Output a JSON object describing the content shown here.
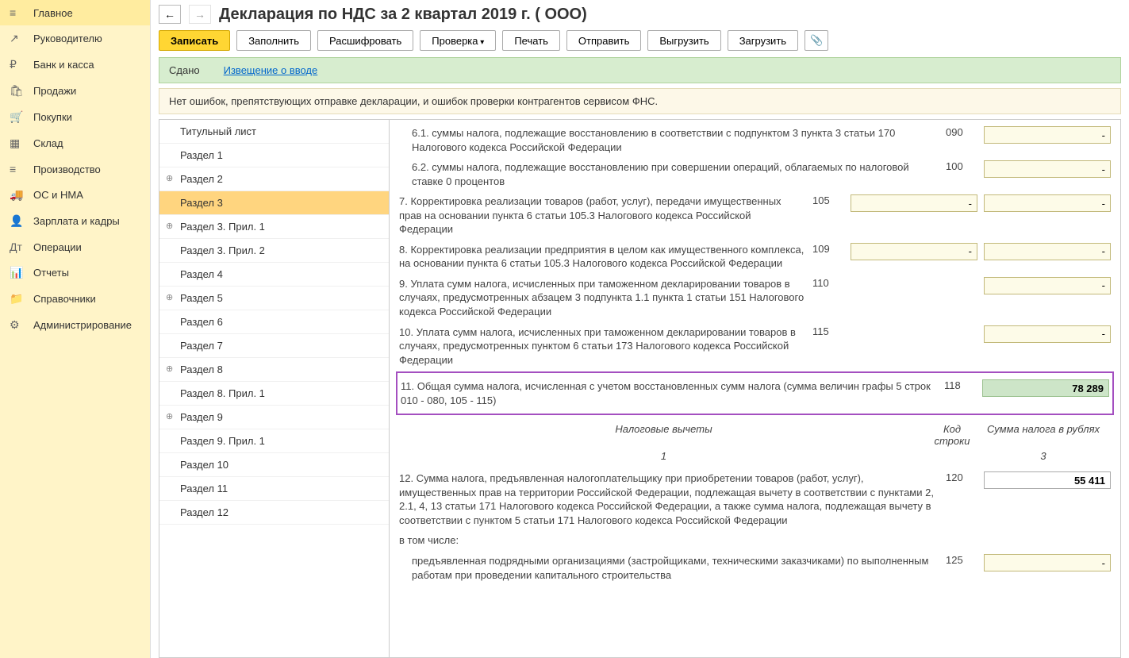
{
  "sidebar": {
    "items": [
      {
        "icon": "≡",
        "label": "Главное"
      },
      {
        "icon": "↗",
        "label": "Руководителю"
      },
      {
        "icon": "₽",
        "label": "Банк и касса"
      },
      {
        "icon": "🛍",
        "label": "Продажи"
      },
      {
        "icon": "🛒",
        "label": "Покупки"
      },
      {
        "icon": "▦",
        "label": "Склад"
      },
      {
        "icon": "≡",
        "label": "Производство"
      },
      {
        "icon": "🚚",
        "label": "ОС и НМА"
      },
      {
        "icon": "👤",
        "label": "Зарплата и кадры"
      },
      {
        "icon": "Дт",
        "label": "Операции"
      },
      {
        "icon": "📊",
        "label": "Отчеты"
      },
      {
        "icon": "📁",
        "label": "Справочники"
      },
      {
        "icon": "⚙",
        "label": "Администрирование"
      }
    ]
  },
  "header": {
    "title": "Декларация по НДС за 2 квартал 2019 г. ( ООО)"
  },
  "toolbar": {
    "write": "Записать",
    "fill": "Заполнить",
    "decode": "Расшифровать",
    "check": "Проверка",
    "print": "Печать",
    "send": "Отправить",
    "export": "Выгрузить",
    "import": "Загрузить"
  },
  "status": {
    "label": "Сдано",
    "link": "Извещение о вводе"
  },
  "check_msg": "Нет ошибок, препятствующих отправке декларации, и ошибок проверки контрагентов сервисом ФНС.",
  "tree": [
    {
      "label": "Титульный лист",
      "exp": false
    },
    {
      "label": "Раздел 1",
      "exp": false
    },
    {
      "label": "Раздел 2",
      "exp": true
    },
    {
      "label": "Раздел 3",
      "exp": false,
      "active": true
    },
    {
      "label": "Раздел 3. Прил. 1",
      "exp": true
    },
    {
      "label": "Раздел 3. Прил. 2",
      "exp": false
    },
    {
      "label": "Раздел 4",
      "exp": false
    },
    {
      "label": "Раздел 5",
      "exp": true
    },
    {
      "label": "Раздел 6",
      "exp": false
    },
    {
      "label": "Раздел 7",
      "exp": false
    },
    {
      "label": "Раздел 8",
      "exp": true
    },
    {
      "label": "Раздел 8. Прил. 1",
      "exp": false
    },
    {
      "label": "Раздел 9",
      "exp": true
    },
    {
      "label": "Раздел 9. Прил. 1",
      "exp": false
    },
    {
      "label": "Раздел 10",
      "exp": false
    },
    {
      "label": "Раздел 11",
      "exp": false
    },
    {
      "label": "Раздел 12",
      "exp": false
    }
  ],
  "rows": [
    {
      "text": "6.1. суммы налога, подлежащие восстановлению в соответствии с подпунктом 3 пункта 3 статьи 170 Налогового кодекса Российской Федерации",
      "code": "090",
      "v1": "-",
      "v2": null,
      "indent": true
    },
    {
      "text": "6.2. суммы налога, подлежащие восстановлению при совершении операций, облагаемых по налоговой ставке 0 процентов",
      "code": "100",
      "v1": "-",
      "v2": null,
      "indent": true
    },
    {
      "text": "7. Корректировка реализации товаров (работ, услуг), передачи имущественных прав на основании пункта 6 статьи 105.3 Налогового кодекса Российской Федерации",
      "code": "105",
      "v1": "-",
      "v2": "-",
      "indent": false
    },
    {
      "text": "8. Корректировка реализации предприятия в целом как имущественного комплекса, на основании пункта 6 статьи 105.3 Налогового кодекса Российской Федерации",
      "code": "109",
      "v1": "-",
      "v2": "-",
      "indent": false
    },
    {
      "text": "9. Уплата сумм налога, исчисленных при таможенном декларировании товаров в случаях, предусмотренных абзацем 3 подпункта 1.1 пункта 1 статьи 151 Налогового кодекса Российской Федерации",
      "code": "110",
      "v1": null,
      "v2": "-",
      "indent": false
    },
    {
      "text": "10. Уплата сумм налога, исчисленных при таможенном декларировании товаров в случаях, предусмотренных пунктом 6 статьи 173 Налогового кодекса Российской Федерации",
      "code": "115",
      "v1": null,
      "v2": "-",
      "indent": false
    }
  ],
  "highlight": {
    "text": "11. Общая сумма налога, исчисленная с учетом восстановленных сумм налога (сумма величин графы 5 строк 010 - 080, 105 - 115)",
    "code": "118",
    "value": "78 289"
  },
  "section_header": {
    "c1": "Налоговые вычеты",
    "c2": "Код строки",
    "c3": "Сумма налога в рублях",
    "n1": "1",
    "n3": "3"
  },
  "row12": {
    "text": "12. Сумма налога, предъявленная налогоплательщику при приобретении товаров (работ, услуг), имущественных прав на территории Российской Федерации, подлежащая вычету в соответствии с пунктами 2, 2.1, 4, 13 статьи 171 Налогового кодекса Российской Федерации, а также сумма налога, подлежащая вычету в соответствии с пунктом 5 статьи 171 Налогового кодекса Российской Федерации",
    "code": "120",
    "value": "55 411"
  },
  "including": "в том числе:",
  "row12sub": {
    "text": "предъявленная подрядными организациями (застройщиками, техническими заказчиками) по выполненным работам при проведении капитального строительства",
    "code": "125",
    "value": "-"
  }
}
